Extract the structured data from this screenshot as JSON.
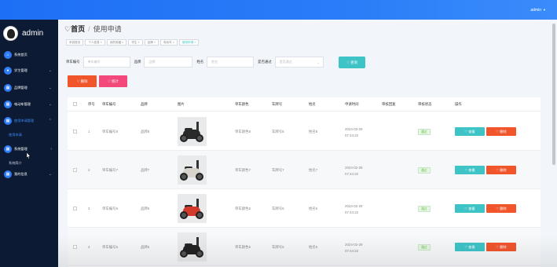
{
  "topbar": {
    "user": "admin"
  },
  "sidebar": {
    "brand": "admin",
    "items": [
      {
        "label": "系统首页",
        "icon": "home-icon"
      },
      {
        "label": "学生管理",
        "icon": "user-icon"
      },
      {
        "label": "品牌管理",
        "icon": "grid-icon"
      },
      {
        "label": "电动车管理",
        "icon": "grid-icon"
      },
      {
        "label": "使用申请管理",
        "icon": "grid-icon"
      },
      {
        "label": "系统管理",
        "icon": "grid-icon"
      },
      {
        "label": "我的信息",
        "icon": "grid-icon"
      }
    ],
    "sub_apply": "使用申请",
    "sub_system": "系统简介"
  },
  "breadcrumb": {
    "home": "首页",
    "current": "使用申请"
  },
  "tabs": [
    "系统首页",
    "个人信息",
    "我的收藏",
    "学生",
    "品牌",
    "电动车",
    "使用申请"
  ],
  "search": {
    "label_number": "单车编号",
    "ph_number": "单车编号",
    "label_brand": "品牌",
    "ph_brand": "品牌",
    "label_name": "姓名",
    "ph_name": "姓名",
    "label_pass": "是否通过",
    "ph_pass": "是否通过",
    "query": "查询"
  },
  "actions": {
    "delete": "删除",
    "stats": "统计"
  },
  "table": {
    "headers": [
      "序号",
      "单车编号",
      "品牌",
      "图片",
      "单车颜色",
      "车牌号",
      "姓名",
      "申请时间",
      "审核回复",
      "审核状态",
      "操作"
    ],
    "rows": [
      {
        "index": "1",
        "number": "单车编号8",
        "brand": "品牌8",
        "color": "单车颜色8",
        "plate": "车牌号8",
        "name": "姓名8",
        "time": "2024-02-29 07:44:22",
        "status": "通过",
        "bike": "#2a2a2a"
      },
      {
        "index": "2",
        "number": "单车编号7",
        "brand": "品牌7",
        "color": "单车颜色7",
        "plate": "车牌号7",
        "name": "姓名7",
        "time": "2024-02-29 07:44:22",
        "status": "通过",
        "bike": "#d8d4cc"
      },
      {
        "index": "3",
        "number": "单车编号6",
        "brand": "品牌6",
        "color": "单车颜色6",
        "plate": "车牌号6",
        "name": "姓名6",
        "time": "2024-02-29 07:44:22",
        "status": "通过",
        "bike": "#d33a2c"
      },
      {
        "index": "4",
        "number": "单车编号5",
        "brand": "品牌5",
        "color": "单车颜色5",
        "plate": "车牌号5",
        "name": "姓名5",
        "time": "2024-02-29 07:44:22",
        "status": "通过",
        "bike": "#222222"
      }
    ],
    "view_label": "查看",
    "delete_label": "删除"
  },
  "colors": {
    "topbar": "#1e6ff5",
    "sidebar": "#0d1a33",
    "accent": "#3ec3c7",
    "danger": "#f0552c",
    "pink": "#f2487a"
  }
}
